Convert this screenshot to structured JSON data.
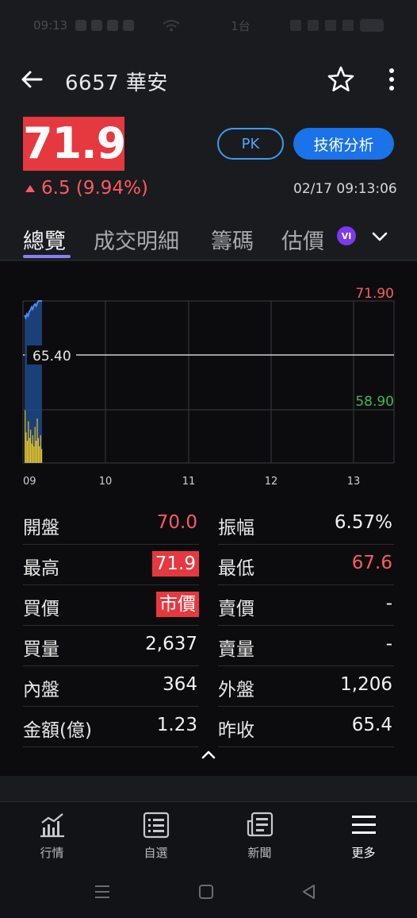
{
  "status_bar": {
    "time": "09:13",
    "carrier": "1台"
  },
  "header": {
    "title": "6657 華安"
  },
  "quote": {
    "price": "71.9",
    "change": "6.5 (9.94%)",
    "timestamp": "02/17 09:13:06",
    "pk_label": "PK",
    "ta_label": "技術分析"
  },
  "tabs": [
    {
      "label": "總覽"
    },
    {
      "label": "成交明細"
    },
    {
      "label": "籌碼"
    },
    {
      "label": "估價"
    }
  ],
  "vip_badge": "VI",
  "chart_data": {
    "type": "line",
    "x_ticks": [
      "09",
      "10",
      "11",
      "12",
      "13"
    ],
    "high_label": "71.90",
    "ref_label": "65.40",
    "low_label": "58.90",
    "ylim": [
      58.9,
      71.9
    ],
    "reference": 65.4,
    "price_series": [
      69.6,
      69.2,
      69.8,
      69.5,
      70.2,
      70.4,
      70.9,
      70.6,
      71.2,
      71.4,
      71.1,
      71.6,
      71.9,
      71.9,
      71.9,
      71.9
    ],
    "volume_series": [
      0.95,
      0.55,
      0.4,
      0.75,
      0.45,
      0.6,
      0.35,
      0.5,
      0.3,
      0.65,
      0.4,
      0.8,
      0.45,
      0.3,
      0.5,
      0.25
    ],
    "colors": {
      "line": "#4c8df6",
      "fill": "#1e4a8a",
      "volume": "#e3c02a",
      "high": "#ff5a5f",
      "low": "#3fb950"
    }
  },
  "stats": [
    {
      "left": {
        "label": "開盤",
        "value": "70.0",
        "style": "red"
      },
      "right": {
        "label": "振幅",
        "value": "6.57%",
        "style": "plain"
      }
    },
    {
      "left": {
        "label": "最高",
        "value": "71.9",
        "style": "boxed"
      },
      "right": {
        "label": "最低",
        "value": "67.6",
        "style": "red"
      }
    },
    {
      "left": {
        "label": "買價",
        "value": "市價",
        "style": "boxed"
      },
      "right": {
        "label": "賣價",
        "value": "-",
        "style": "plain"
      }
    },
    {
      "left": {
        "label": "買量",
        "value": "2,637",
        "style": "plain"
      },
      "right": {
        "label": "賣量",
        "value": "-",
        "style": "plain"
      }
    },
    {
      "left": {
        "label": "內盤",
        "value": "364",
        "style": "plain"
      },
      "right": {
        "label": "外盤",
        "value": "1,206",
        "style": "plain"
      }
    },
    {
      "left": {
        "label": "金額(億)",
        "value": "1.23",
        "style": "plain"
      },
      "right": {
        "label": "昨收",
        "value": "65.4",
        "style": "plain"
      }
    }
  ],
  "bottom_nav": [
    {
      "label": "行情",
      "icon": "chart-icon"
    },
    {
      "label": "自選",
      "icon": "list-icon"
    },
    {
      "label": "新聞",
      "icon": "news-icon"
    },
    {
      "label": "更多",
      "icon": "menu-icon"
    }
  ]
}
